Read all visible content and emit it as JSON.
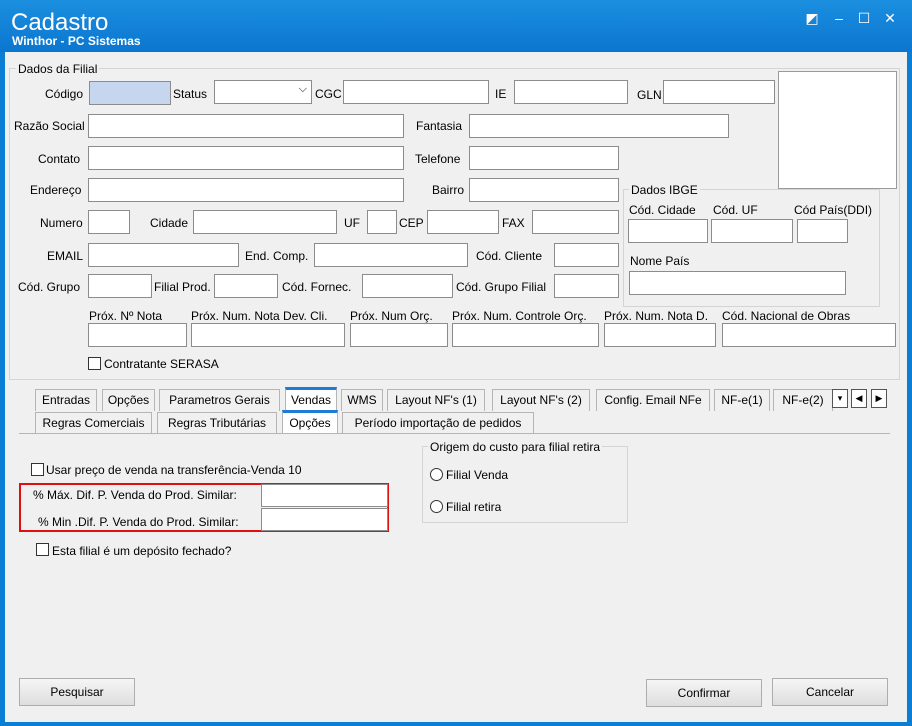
{
  "window": {
    "title": "Cadastro",
    "subtitle": "Winthor - PC Sistemas",
    "controls": [
      "◩",
      "–",
      "☐",
      "✕"
    ]
  },
  "dados_filial": {
    "group_title": "Dados da Filial",
    "labels": {
      "codigo": "Código",
      "status": "Status",
      "cgc": "CGC",
      "ie": "IE",
      "gln": "GLN",
      "razao_social": "Razão Social",
      "fantasia": "Fantasia",
      "contato": "Contato",
      "telefone": "Telefone",
      "endereco": "Endereço",
      "bairro": "Bairro",
      "numero": "Numero",
      "cidade": "Cidade",
      "uf": "UF",
      "cep": "CEP",
      "fax": "FAX",
      "email": "EMAIL",
      "end_comp": "End. Comp.",
      "cod_cliente": "Cód. Cliente",
      "cod_grupo": "Cód. Grupo",
      "filial_prod": "Filial Prod.",
      "cod_fornec": "Cód. Fornec.",
      "cod_grupo_filial": "Cód. Grupo Filial",
      "prox_nota": "Próx. Nº Nota",
      "prox_nota_dev": "Próx. Num. Nota Dev. Cli.",
      "prox_orc": "Próx. Num Orç.",
      "prox_controle_orc": "Próx. Num. Controle Orç.",
      "prox_nota_d": "Próx. Num. Nota D.",
      "cod_nacional_obras": "Cód. Nacional de Obras",
      "contratante_serasa": "Contratante SERASA"
    },
    "ibge": {
      "group_title": "Dados IBGE",
      "cod_cidade": "Cód. Cidade",
      "cod_uf": "Cód. UF",
      "cod_pais": "Cód País(DDI)",
      "nome_pais": "Nome País"
    }
  },
  "tabs_row1": [
    "Entradas",
    "Opções",
    "Parametros Gerais",
    "Vendas",
    "WMS",
    "Layout NF's (1)",
    "Layout NF's (2)",
    "Config. Email NFe",
    "NF-e(1)",
    "NF-e(2)"
  ],
  "tabs_row2": [
    "Regras Comerciais",
    "Regras Tributárias",
    "Opções",
    "Período importação de pedidos"
  ],
  "tab_nav": [
    "▾",
    "◀",
    "▶"
  ],
  "opcoes": {
    "usar_preco": "Usar preço de venda na transferência-Venda 10",
    "max_dif": "% Máx. Dif. P. Venda do Prod. Similar:",
    "min_dif": "% Min .Dif. P. Venda do Prod. Similar:",
    "deposito_fechado": "Esta filial é um depósito fechado?",
    "origem": {
      "group_title": "Origem do custo para filial retira",
      "filial_venda": "Filial Venda",
      "filial_retira": "Filial retira"
    }
  },
  "buttons": {
    "pesquisar": "Pesquisar",
    "confirmar": "Confirmar",
    "cancelar": "Cancelar"
  }
}
